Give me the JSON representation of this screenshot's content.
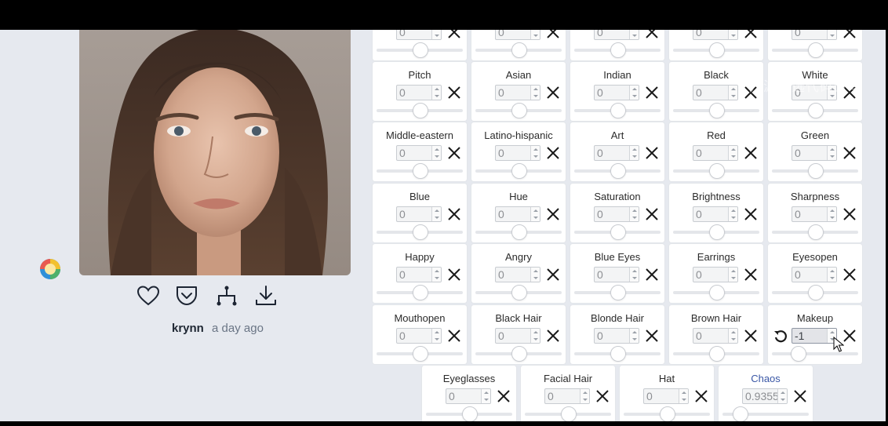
{
  "post": {
    "username": "krynn",
    "time_ago": "a day ago"
  },
  "icons": {
    "like": "heart-icon",
    "save": "pocket-save-icon",
    "remix": "branch-icon",
    "download": "download-icon",
    "clear": "close-icon",
    "reset": "undo-icon",
    "avatar": "colorful-avatar-icon"
  },
  "watermark": "开源精选代码分享",
  "sliders": {
    "top_row_partial": [
      {
        "value": "0",
        "level": 0.5
      },
      {
        "value": "0",
        "level": 0.5
      },
      {
        "value": "0",
        "level": 0.5
      },
      {
        "value": "0",
        "level": 0.5
      },
      {
        "value": "0",
        "level": 0.5
      }
    ],
    "rows": [
      [
        {
          "label": "Pitch",
          "value": "0",
          "level": 0.5
        },
        {
          "label": "Asian",
          "value": "0",
          "level": 0.5
        },
        {
          "label": "Indian",
          "value": "0",
          "level": 0.5
        },
        {
          "label": "Black",
          "value": "0",
          "level": 0.5
        },
        {
          "label": "White",
          "value": "0",
          "level": 0.5
        }
      ],
      [
        {
          "label": "Middle-eastern",
          "value": "0",
          "level": 0.5
        },
        {
          "label": "Latino-hispanic",
          "value": "0",
          "level": 0.5
        },
        {
          "label": "Art",
          "value": "0",
          "level": 0.5
        },
        {
          "label": "Red",
          "value": "0",
          "level": 0.5
        },
        {
          "label": "Green",
          "value": "0",
          "level": 0.5
        }
      ],
      [
        {
          "label": "Blue",
          "value": "0",
          "level": 0.5
        },
        {
          "label": "Hue",
          "value": "0",
          "level": 0.5
        },
        {
          "label": "Saturation",
          "value": "0",
          "level": 0.5
        },
        {
          "label": "Brightness",
          "value": "0",
          "level": 0.5
        },
        {
          "label": "Sharpness",
          "value": "0",
          "level": 0.5
        }
      ],
      [
        {
          "label": "Happy",
          "value": "0",
          "level": 0.5
        },
        {
          "label": "Angry",
          "value": "0",
          "level": 0.5
        },
        {
          "label": "Blue Eyes",
          "value": "0",
          "level": 0.5
        },
        {
          "label": "Earrings",
          "value": "0",
          "level": 0.5
        },
        {
          "label": "Eyesopen",
          "value": "0",
          "level": 0.5
        }
      ],
      [
        {
          "label": "Mouthopen",
          "value": "0",
          "level": 0.5
        },
        {
          "label": "Black Hair",
          "value": "0",
          "level": 0.5
        },
        {
          "label": "Blonde Hair",
          "value": "0",
          "level": 0.5
        },
        {
          "label": "Brown Hair",
          "value": "0",
          "level": 0.5
        },
        {
          "label": "Makeup",
          "value": "-1",
          "level": 0.3,
          "active": true
        }
      ]
    ],
    "last_row": [
      {
        "label": "Eyeglasses",
        "value": "0",
        "level": 0.5
      },
      {
        "label": "Facial Hair",
        "value": "0",
        "level": 0.5
      },
      {
        "label": "Hat",
        "value": "0",
        "level": 0.5
      },
      {
        "label": "Chaos",
        "value": "0.9355",
        "level": 0.2,
        "highlight": true
      }
    ]
  }
}
